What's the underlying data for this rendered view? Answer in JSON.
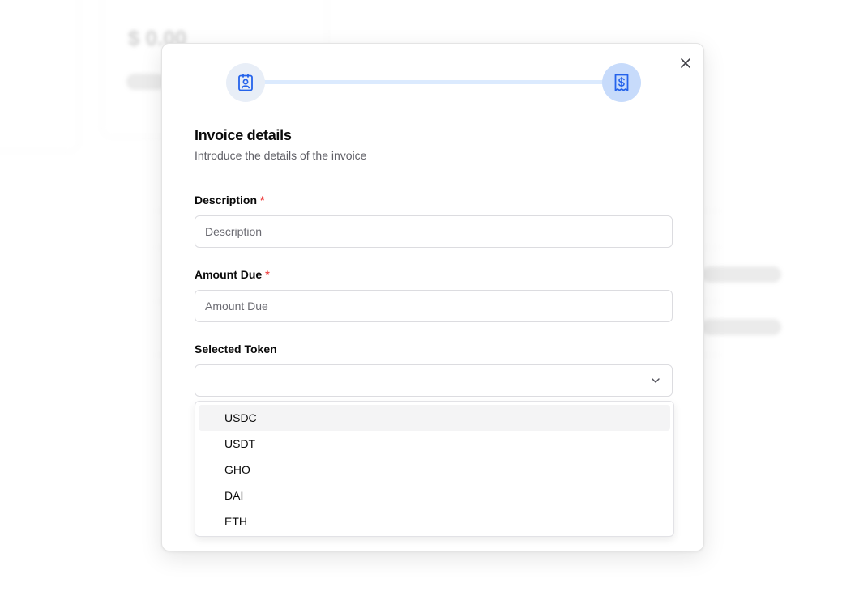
{
  "modal": {
    "title": "Invoice details",
    "subtitle": "Introduce the details of the invoice",
    "steps": [
      {
        "icon": "contact-clipboard-icon",
        "state": "completed"
      },
      {
        "icon": "dollar-receipt-icon",
        "state": "active"
      }
    ],
    "description": {
      "label": "Description",
      "required_mark": "*",
      "placeholder": "Description",
      "value": ""
    },
    "amount_due": {
      "label": "Amount Due",
      "required_mark": "*",
      "placeholder": "Amount Due",
      "value": ""
    },
    "selected_token": {
      "label": "Selected Token",
      "value": "",
      "highlighted_option": "USDC",
      "options": [
        "USDC",
        "USDT",
        "GHO",
        "DAI",
        "ETH"
      ]
    }
  },
  "colors": {
    "accent": "#2563eb",
    "required": "#ef4444",
    "step_track": "#dbeafe"
  }
}
